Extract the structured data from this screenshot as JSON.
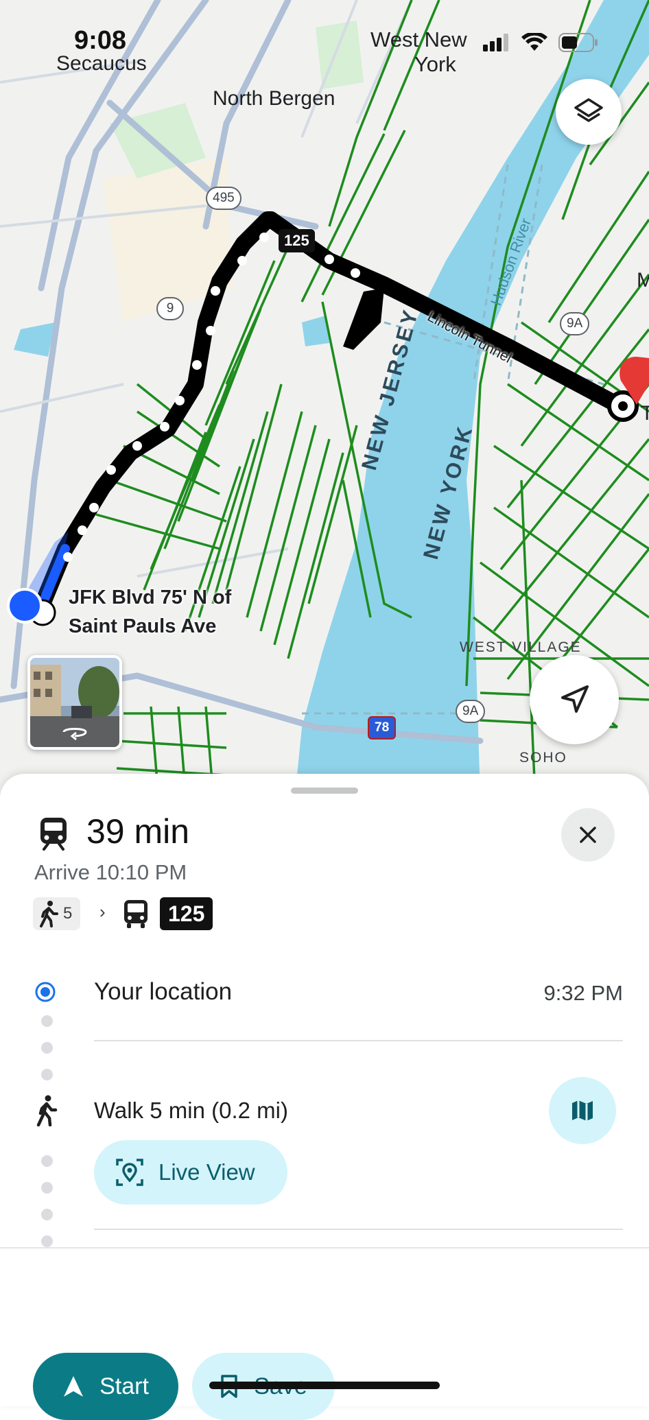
{
  "status_bar": {
    "time": "9:08",
    "icons": [
      "signal-icon",
      "wifi-icon",
      "battery-icon"
    ]
  },
  "map": {
    "labels": {
      "secaucus": "Secaucus",
      "north_bergen": "North Bergen",
      "west_new_york_1": "West New",
      "west_new_york_2": "York",
      "new_jersey": "NEW JERSEY",
      "new_york": "NEW YORK",
      "hudson_river": "Hudson River",
      "lincoln_tunnel": "Lincoln Tunnel",
      "west_village": "WEST VILLAGE",
      "soho": "SOHO",
      "m_edge": "M",
      "t_edge": "T"
    },
    "shields": {
      "r495": "495",
      "r9": "9",
      "r9a_top": "9A",
      "r9a_bottom": "9A",
      "i78": "78"
    },
    "bus_route_tag": "125",
    "stop_label_line1": "JFK Blvd 75' N of",
    "stop_label_line2": "Saint Pauls Ave",
    "icons": [
      "layers-icon",
      "navigation-arrow-icon",
      "street-view-rotate-icon"
    ]
  },
  "sheet": {
    "duration": "39 min",
    "arrive": "Arrive 10:10 PM",
    "walk_chip_minutes": "5",
    "route_chip": "125",
    "steps": {
      "origin_label": "Your location",
      "origin_time": "9:32 PM",
      "walk_label": "Walk 5 min (0.2 mi)",
      "live_view_label": "Live View"
    },
    "actions": {
      "start_label": "Start",
      "save_label": "Save"
    }
  },
  "colors": {
    "accent": "#0b7c86",
    "accent_light": "#d3f4fb",
    "water": "#8fd3ea",
    "transit_line": "#1a8a1a",
    "route": "#000000",
    "origin_dot": "#1a5cff",
    "destination_pin": "#e53935"
  }
}
